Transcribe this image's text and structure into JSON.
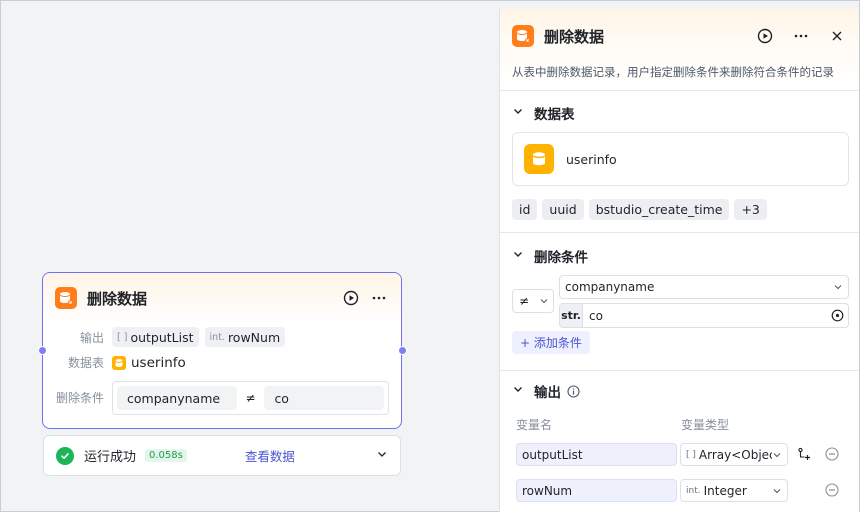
{
  "node": {
    "title": "删除数据",
    "output_label": "输出",
    "outputs": [
      {
        "type": "[ ]",
        "name": "outputList"
      },
      {
        "type": "int.",
        "name": "rowNum"
      }
    ],
    "table_label": "数据表",
    "table_name": "userinfo",
    "cond_label": "删除条件",
    "cond_field": "companyname",
    "cond_op": "≠",
    "cond_value": "co"
  },
  "run": {
    "status": "运行成功",
    "time": "0.058s",
    "view": "查看数据"
  },
  "panel": {
    "title": "删除数据",
    "description": "从表中删除数据记录，用户指定删除条件来删除符合条件的记录",
    "table_section": "数据表",
    "table_name": "userinfo",
    "fields": [
      "id",
      "uuid",
      "bstudio_create_time",
      "+3"
    ],
    "cond_section": "删除条件",
    "op": "≠",
    "field": "companyname",
    "value_type": "str.",
    "value": "co",
    "add_cond": "+ 添加条件",
    "output_section": "输出",
    "col_name": "变量名",
    "col_type": "变量类型",
    "outputs": [
      {
        "name": "outputList",
        "type_tag": "[ ]",
        "type": "Array<Object>"
      },
      {
        "name": "rowNum",
        "type_tag": "int.",
        "type": "Integer"
      }
    ]
  },
  "colors": {
    "accent": "#4a55d1",
    "node_border": "#6f6ff0",
    "icon_orange": "#ff7d1a",
    "icon_yellow": "#ffb300",
    "success": "#1cb55a"
  }
}
